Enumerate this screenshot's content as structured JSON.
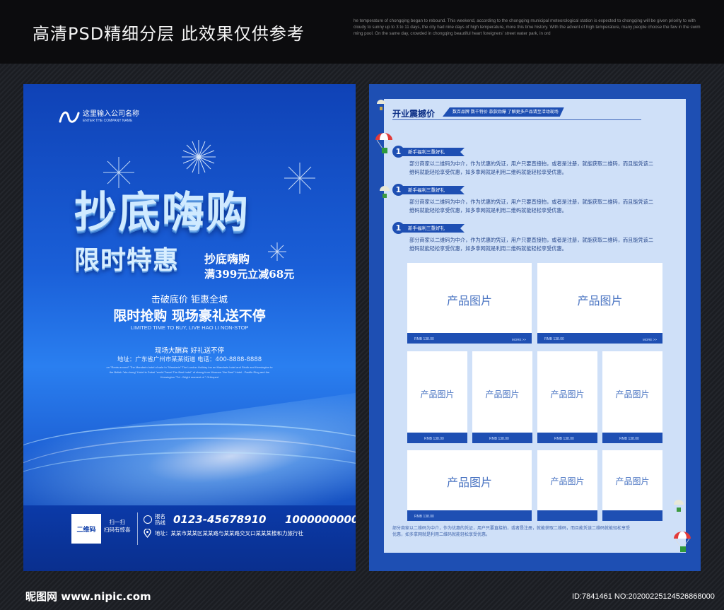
{
  "banner": {
    "title": "高清PSD精细分层 此效果仅供参考",
    "fine_text": "he temperature of chongqing began to rebound. This weekend, according to the chongqing municipal meteorological station is expected to chongqing will be given priority to with cloudy to sunny up to 3 to 11 days, the city had nine days of high temperature, more this time history. With the advent of high temperature, many people choose the few in the swim ming pool. On the same day, crowded in chongqing beautiful heart foreigners' street water park, in ord"
  },
  "left_flyer": {
    "company": "这里输入公司名称",
    "company_sub": "ENTER THE COMPANY NAME",
    "hero_title": "抄底嗨购",
    "hero_subtitle": "限时特惠",
    "side_title": "抄底嗨购",
    "side_offer": "满399元立减68元",
    "tagline1": "击破底价 钜惠全城",
    "tagline2": "限时抢购 现场豪礼送不停",
    "tagline_en": "LIMITED TIME TO BUY, LIVE HAO LI NON-STOP",
    "event_line": "现场大酬宾 好礼送不停",
    "address_line": "地址：广东省广州市某某街道  电话：400-8888-8888",
    "event_fine": "on \"Rents around\" The Mandarin hotel of sale In \"Mandarin\" The London Holiday Inn an Mandarin hotel and Sindh and Kensington to the British \"aku bung\" Hotel in Dubai \"world Travel The Best hotel\" of shang from Moscow \"the Best\" Hotel - Pacific Ring and the Kensington \"Tol - Bright moment of \" Orthoped",
    "qr_label": "二维码",
    "scan_line1": "扫一扫",
    "scan_line2": "扫码有惊喜",
    "hotline_label": "报名热线",
    "phone1": "0123-45678910",
    "phone2": "1000000000",
    "address2": "地址：某某市某某区某某路与某某路交叉口某某某楼和力旅行社"
  },
  "right_flyer": {
    "section_title": "开业震撼价",
    "section_sub": "数百品牌 数千特价  款款劲爆  了解更多产品请至活动现场",
    "items": [
      {
        "num": "1",
        "ribbon": "新手福利三重好礼",
        "text": "部分商家以二维码为中介，作为优惠的凭证，用户只要直接拍，或者是注册，就能获取二维码，而且能凭该二维码就能轻松享受优惠，如多拿网就是利用二维码就能轻松享受优惠。"
      },
      {
        "num": "1",
        "ribbon": "新手福利三重好礼",
        "text": "部分商家以二维码为中介，作为优惠的凭证，用户只要直接拍，或者是注册，就能获取二维码，而且能凭该二维码就能轻松享受优惠，如多拿网就是利用二维码就能轻松享受优惠。"
      },
      {
        "num": "1",
        "ribbon": "新手福利三重好礼",
        "text": "部分商家以二维码为中介，作为优惠的凭证，用户只要直接拍，或者是注册，就能获取二维码，而且能凭该二维码就能轻松享受优惠，如多拿网就是利用二维码就能轻松享受优惠。"
      }
    ],
    "product_label": "产品图片",
    "price": "RMB 138.00",
    "more": "MORE >>",
    "footer_text": "部分商家以二维码为中介，作为优惠的凭证，用户只要直接拍，或者是注册，就能获取二维码，而且能凭该二维码就能轻松享受优惠，如多拿网就是利用二维码就能轻松享受优惠。"
  },
  "watermark": {
    "site": "昵图网 www.nipic.com",
    "id": "ID:7841461 NO:20200225124526868000"
  },
  "colors": {
    "flyer_blue": "#1e4fb3",
    "panel_light": "#cfe0f8",
    "text_dark_blue": "#0d2f86"
  }
}
